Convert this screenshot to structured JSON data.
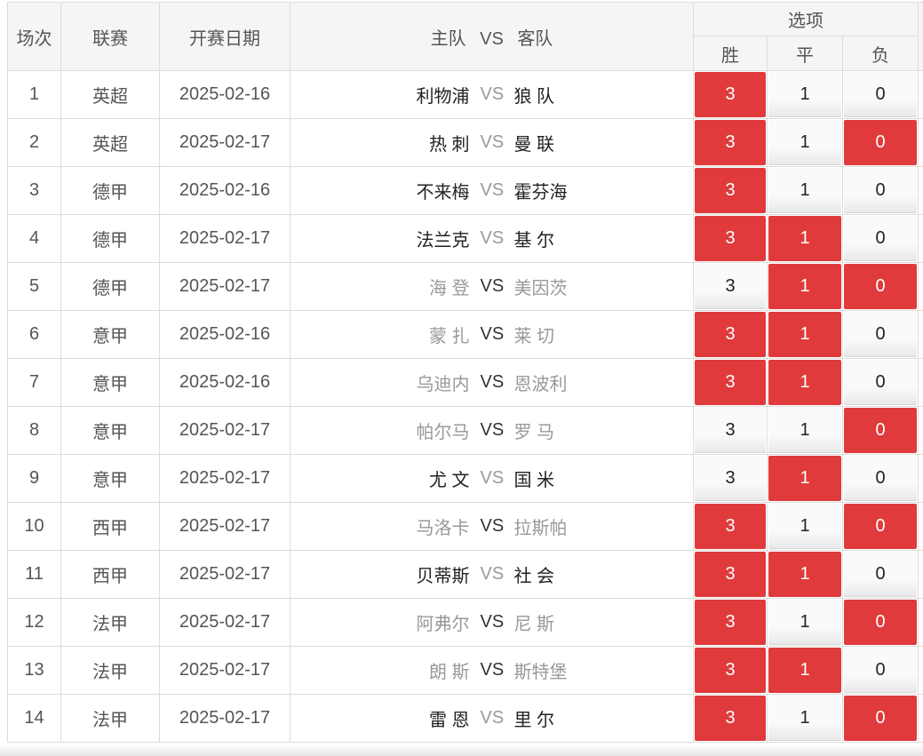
{
  "header": {
    "col_no": "场次",
    "col_league": "联赛",
    "col_date": "开赛日期",
    "col_home": "主队",
    "col_vs": "VS",
    "col_away": "客队",
    "col_options": "选项",
    "opt_win": "胜",
    "opt_draw": "平",
    "opt_lose": "负"
  },
  "rows": [
    {
      "no": "1",
      "league": "英超",
      "date": "2025-02-16",
      "home": "利物浦",
      "vs": "VS",
      "away": "狼 队",
      "win": "3",
      "draw": "1",
      "lose": "0",
      "sel_win": true,
      "sel_draw": false,
      "sel_lose": false,
      "dim": false
    },
    {
      "no": "2",
      "league": "英超",
      "date": "2025-02-17",
      "home": "热 刺",
      "vs": "VS",
      "away": "曼 联",
      "win": "3",
      "draw": "1",
      "lose": "0",
      "sel_win": true,
      "sel_draw": false,
      "sel_lose": true,
      "dim": false
    },
    {
      "no": "3",
      "league": "德甲",
      "date": "2025-02-16",
      "home": "不来梅",
      "vs": "VS",
      "away": "霍芬海",
      "win": "3",
      "draw": "1",
      "lose": "0",
      "sel_win": true,
      "sel_draw": false,
      "sel_lose": false,
      "dim": false
    },
    {
      "no": "4",
      "league": "德甲",
      "date": "2025-02-17",
      "home": "法兰克",
      "vs": "VS",
      "away": "基 尔",
      "win": "3",
      "draw": "1",
      "lose": "0",
      "sel_win": true,
      "sel_draw": true,
      "sel_lose": false,
      "dim": false
    },
    {
      "no": "5",
      "league": "德甲",
      "date": "2025-02-17",
      "home": "海 登",
      "vs": "VS",
      "away": "美因茨",
      "win": "3",
      "draw": "1",
      "lose": "0",
      "sel_win": false,
      "sel_draw": true,
      "sel_lose": true,
      "dim": true
    },
    {
      "no": "6",
      "league": "意甲",
      "date": "2025-02-16",
      "home": "蒙 扎",
      "vs": "VS",
      "away": "莱 切",
      "win": "3",
      "draw": "1",
      "lose": "0",
      "sel_win": true,
      "sel_draw": true,
      "sel_lose": false,
      "dim": true
    },
    {
      "no": "7",
      "league": "意甲",
      "date": "2025-02-16",
      "home": "乌迪内",
      "vs": "VS",
      "away": "恩波利",
      "win": "3",
      "draw": "1",
      "lose": "0",
      "sel_win": true,
      "sel_draw": true,
      "sel_lose": false,
      "dim": true
    },
    {
      "no": "8",
      "league": "意甲",
      "date": "2025-02-17",
      "home": "帕尔马",
      "vs": "VS",
      "away": "罗 马",
      "win": "3",
      "draw": "1",
      "lose": "0",
      "sel_win": false,
      "sel_draw": false,
      "sel_lose": true,
      "dim": true
    },
    {
      "no": "9",
      "league": "意甲",
      "date": "2025-02-17",
      "home": "尤 文",
      "vs": "VS",
      "away": "国 米",
      "win": "3",
      "draw": "1",
      "lose": "0",
      "sel_win": false,
      "sel_draw": true,
      "sel_lose": false,
      "dim": false
    },
    {
      "no": "10",
      "league": "西甲",
      "date": "2025-02-17",
      "home": "马洛卡",
      "vs": "VS",
      "away": "拉斯帕",
      "win": "3",
      "draw": "1",
      "lose": "0",
      "sel_win": true,
      "sel_draw": false,
      "sel_lose": true,
      "dim": true
    },
    {
      "no": "11",
      "league": "西甲",
      "date": "2025-02-17",
      "home": "贝蒂斯",
      "vs": "VS",
      "away": "社 会",
      "win": "3",
      "draw": "1",
      "lose": "0",
      "sel_win": true,
      "sel_draw": true,
      "sel_lose": false,
      "dim": false
    },
    {
      "no": "12",
      "league": "法甲",
      "date": "2025-02-17",
      "home": "阿弗尔",
      "vs": "VS",
      "away": "尼 斯",
      "win": "3",
      "draw": "1",
      "lose": "0",
      "sel_win": true,
      "sel_draw": false,
      "sel_lose": true,
      "dim": true
    },
    {
      "no": "13",
      "league": "法甲",
      "date": "2025-02-17",
      "home": "朗 斯",
      "vs": "VS",
      "away": "斯特堡",
      "win": "3",
      "draw": "1",
      "lose": "0",
      "sel_win": true,
      "sel_draw": true,
      "sel_lose": false,
      "dim": true
    },
    {
      "no": "14",
      "league": "法甲",
      "date": "2025-02-17",
      "home": "雷 恩",
      "vs": "VS",
      "away": "里 尔",
      "win": "3",
      "draw": "1",
      "lose": "0",
      "sel_win": true,
      "sel_draw": false,
      "sel_lose": true,
      "dim": false
    }
  ],
  "colors": {
    "selected": "#e03a3c",
    "header_bg": "#f5f5f5",
    "border": "#dcdcdc"
  }
}
